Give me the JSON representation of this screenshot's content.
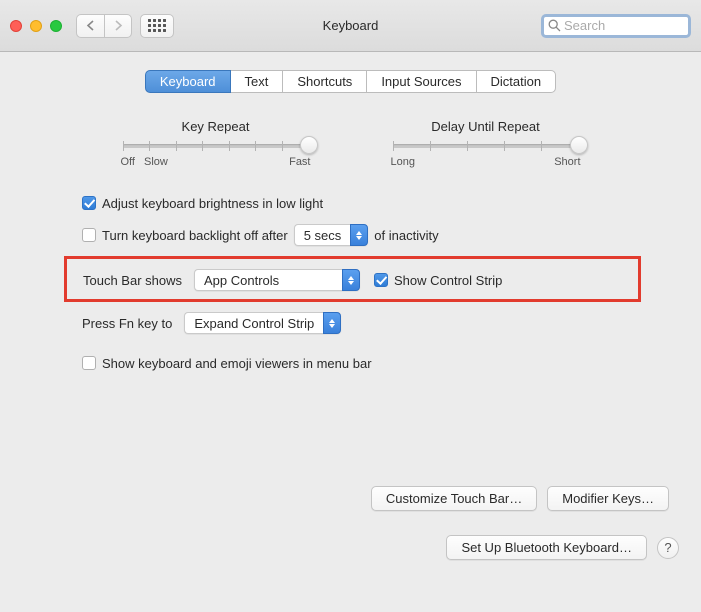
{
  "window": {
    "title": "Keyboard",
    "search_placeholder": "Search"
  },
  "tabs": [
    "Keyboard",
    "Text",
    "Shortcuts",
    "Input Sources",
    "Dictation"
  ],
  "active_tab": 0,
  "sliders": {
    "key_repeat": {
      "label": "Key Repeat",
      "min_label": "Off",
      "slow_label": "Slow",
      "max_label": "Fast",
      "ticks": 8,
      "value_index": 7
    },
    "delay": {
      "label": "Delay Until Repeat",
      "min_label": "Long",
      "max_label": "Short",
      "ticks": 6,
      "value_index": 5
    }
  },
  "options": {
    "adjust_brightness": {
      "label": "Adjust keyboard brightness in low light",
      "checked": true
    },
    "backlight_off": {
      "label": "Turn keyboard backlight off after",
      "checked": false,
      "select_value": "5 secs",
      "suffix": "of inactivity"
    },
    "touch_bar": {
      "label": "Touch Bar shows",
      "select_value": "App Controls",
      "control_strip_label": "Show Control Strip",
      "control_strip_checked": true
    },
    "fn_key": {
      "label": "Press Fn key to",
      "select_value": "Expand Control Strip"
    },
    "show_viewers": {
      "label": "Show keyboard and emoji viewers in menu bar",
      "checked": false
    }
  },
  "buttons": {
    "customize": "Customize Touch Bar…",
    "modifier": "Modifier Keys…",
    "bluetooth": "Set Up Bluetooth Keyboard…",
    "help": "?"
  }
}
